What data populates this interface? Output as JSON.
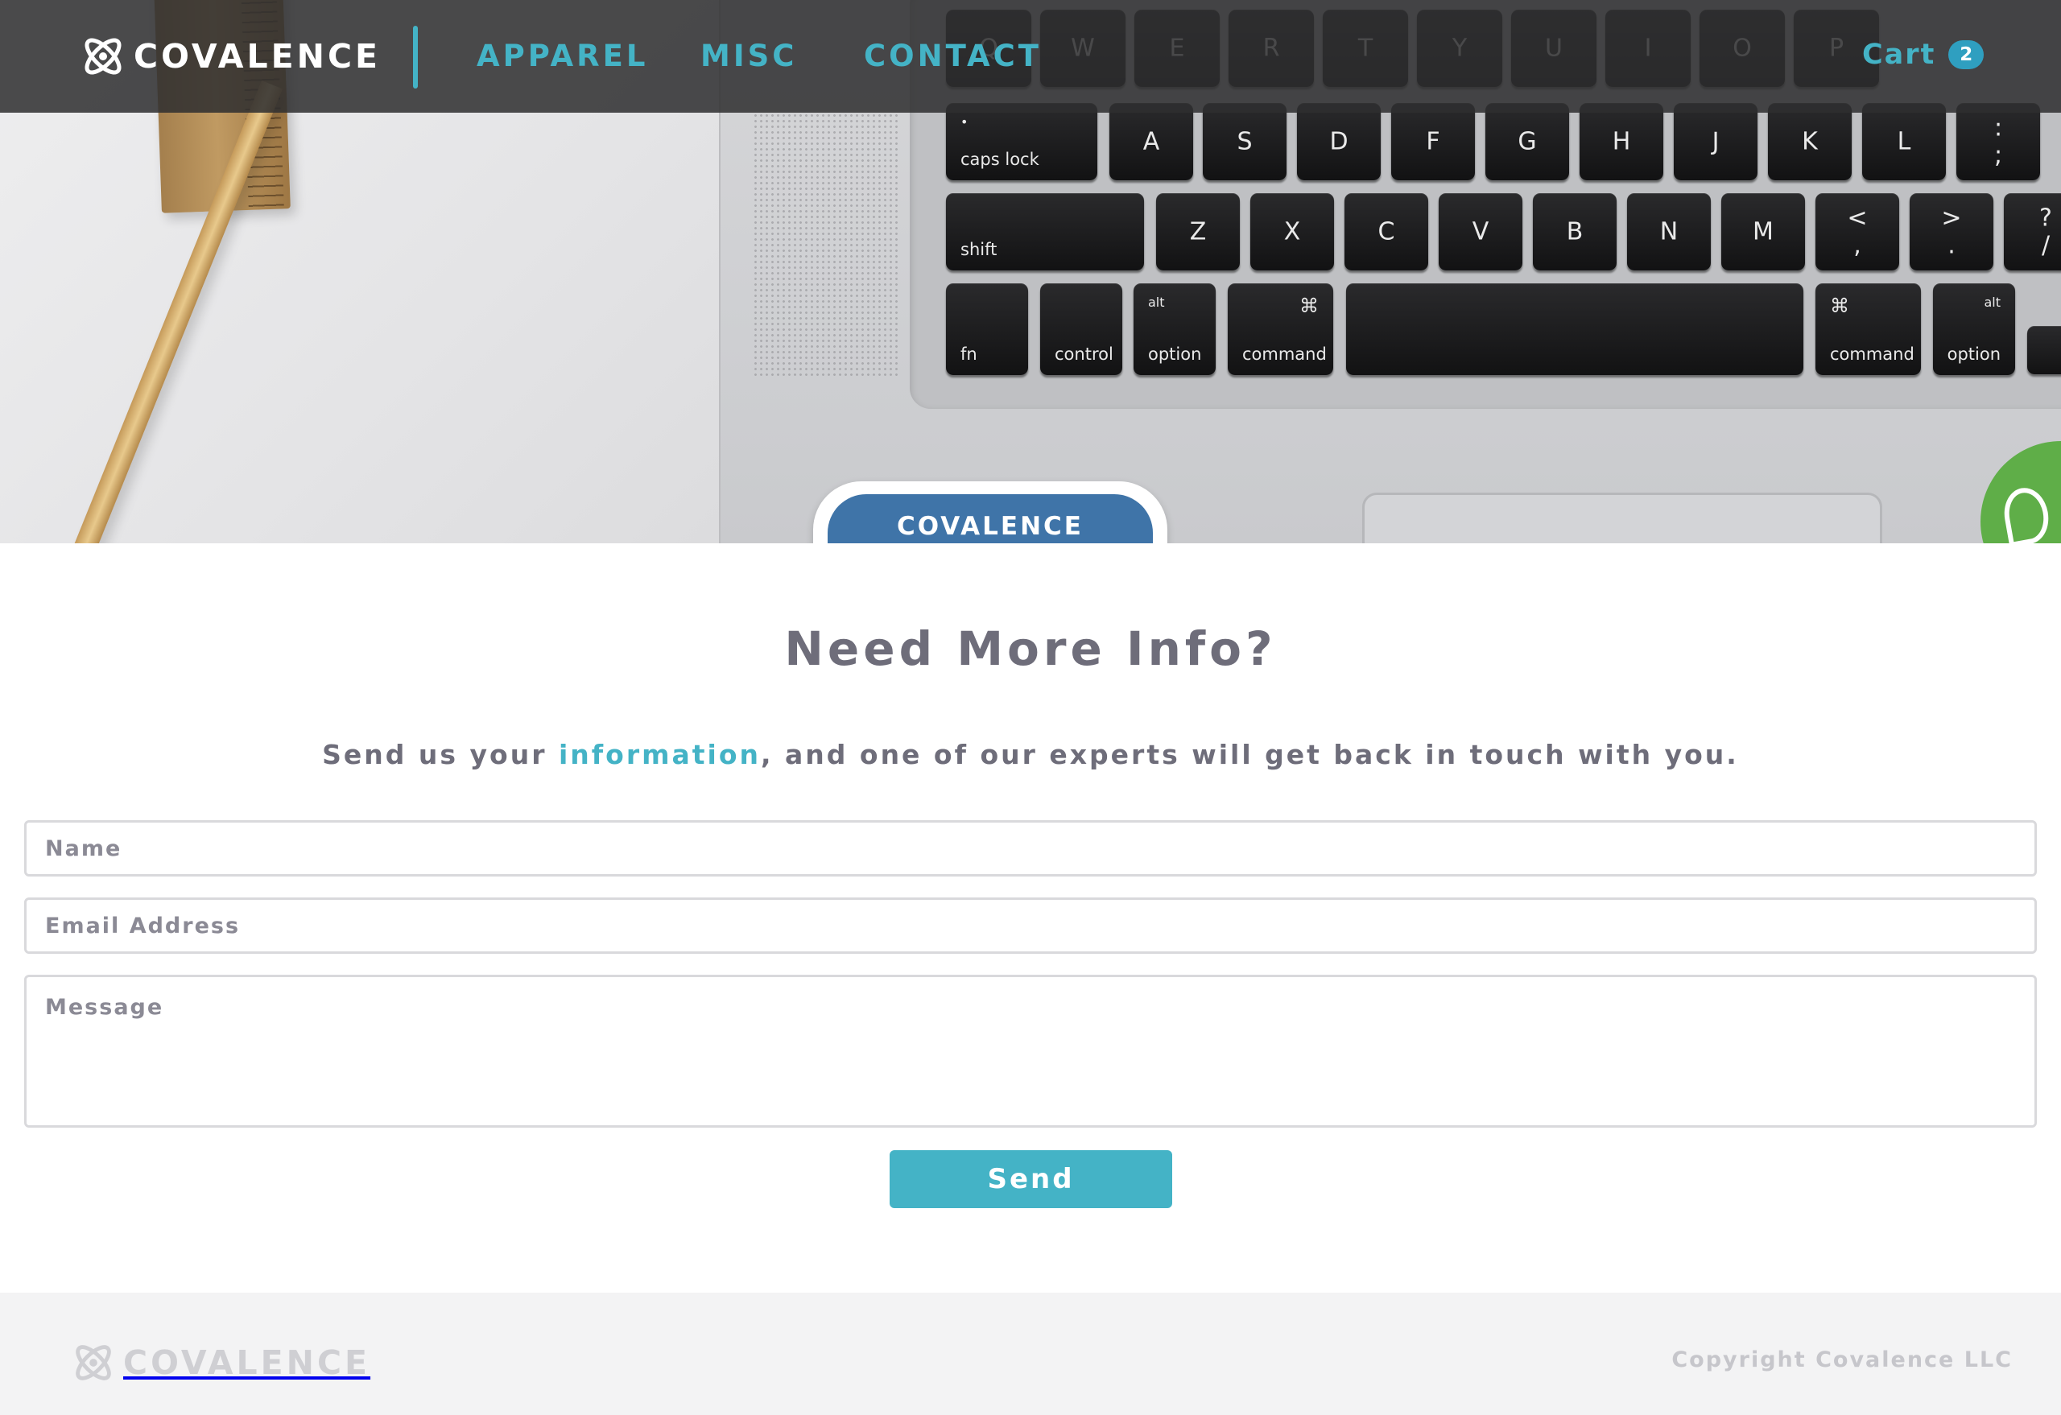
{
  "brand": {
    "name": "COVALENCE",
    "logo_icon": "covalence-atom-logo"
  },
  "nav": {
    "items": [
      {
        "label": "APPAREL"
      },
      {
        "label": "MISC"
      },
      {
        "label": "CONTACT"
      }
    ],
    "cart": {
      "label": "Cart",
      "count": "2"
    }
  },
  "hero": {
    "sticker_text": "COVALENCE",
    "keys": {
      "row1": [
        "Q",
        "W",
        "E",
        "R",
        "T",
        "Y",
        "U",
        "I",
        "O",
        "P"
      ],
      "caps": "caps lock",
      "row2": [
        "A",
        "S",
        "D",
        "F",
        "G",
        "H",
        "J",
        "K",
        "L"
      ],
      "shift": "shift",
      "row3": [
        "Z",
        "X",
        "C",
        "V",
        "B",
        "N",
        "M"
      ],
      "punct": [
        [
          "<",
          ","
        ],
        [
          ">",
          "."
        ],
        [
          "?",
          "/"
        ]
      ],
      "semicolon": [
        ":",
        ";"
      ],
      "fn": "fn",
      "control": "control",
      "option": "option",
      "alt": "alt",
      "command": "command",
      "cmd_symbol": "⌘"
    }
  },
  "contact": {
    "heading": "Need More Info?",
    "subtext_before": "Send us your ",
    "subtext_link": "information",
    "subtext_after": ", and one of our experts will get back in touch with you.",
    "name_placeholder": "Name",
    "email_placeholder": "Email Address",
    "message_placeholder": "Message",
    "send_label": "Send"
  },
  "footer": {
    "brand": "COVALENCE",
    "copyright": "Copyright Covalence LLC"
  },
  "colors": {
    "accent": "#44b3c6",
    "badge": "#2f9fc0",
    "text": "#6e6d7a",
    "nav_bg": "#2e2e30",
    "footer_bg": "#f3f3f4"
  }
}
